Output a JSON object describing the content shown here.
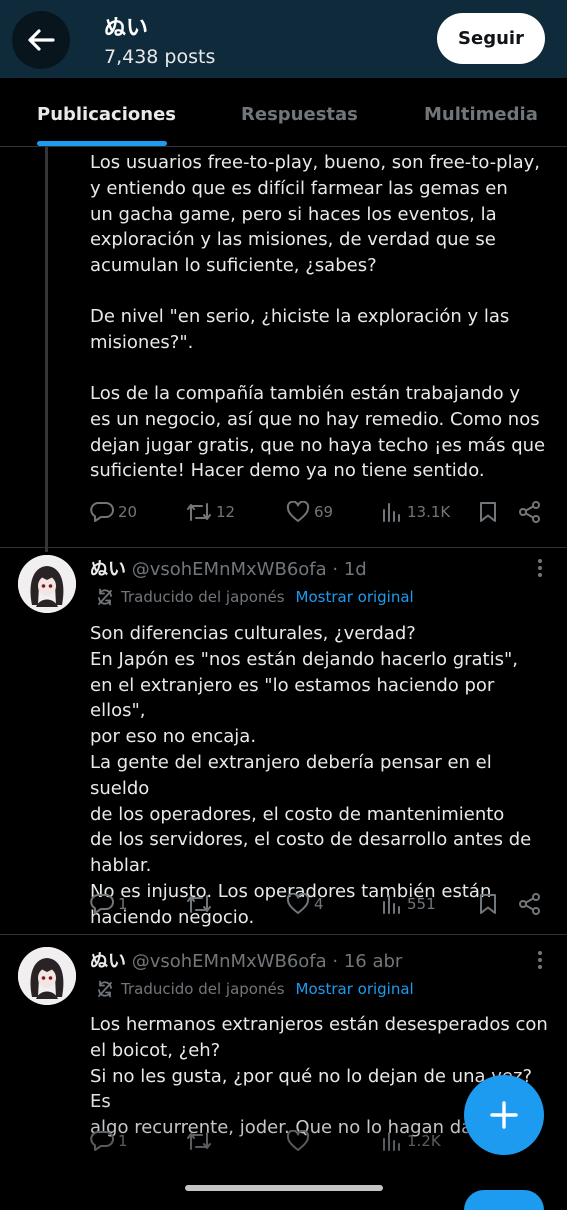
{
  "header": {
    "name": "ぬい",
    "posts_count": "7,438 posts",
    "follow_label": "Seguir"
  },
  "tabs": [
    {
      "label": "Publicaciones",
      "active": true
    },
    {
      "label": "Respuestas",
      "active": false
    },
    {
      "label": "Multimedia",
      "active": false
    }
  ],
  "thread_post": {
    "paragraph_1": "Los usuarios free-to-play, bueno, son free-to-play,\ny entiendo que es difícil farmear las gemas en\nun gacha game, pero si haces los eventos, la\nexploración y las misiones, de verdad que se\nacumulan lo suficiente, ¿sabes?",
    "paragraph_2": "De nivel \"en serio, ¿hiciste la exploración y las\nmisiones?\".",
    "paragraph_3": "Los de la compañía también están trabajando y\nes un negocio, así que no hay remedio. Como nos\ndejan jugar gratis, que no haya techo ¡es más que\nsuficiente! Hacer demo ya no tiene sentido.",
    "replies": "20",
    "reposts": "12",
    "likes": "69",
    "views": "13.1K"
  },
  "post_2": {
    "display_name": "ぬい",
    "handle": "@vsohEMnMxWB6ofa",
    "time": "· 1d",
    "translated_label": "Traducido del japonés",
    "show_original": "Mostrar original",
    "text": "Son diferencias culturales, ¿verdad?\nEn Japón es \"nos están dejando hacerlo gratis\",\nen el extranjero es \"lo estamos haciendo por ellos\",\npor eso no encaja.\nLa gente del extranjero debería pensar en el sueldo\nde los operadores, el costo de mantenimiento\nde los servidores, el costo de desarrollo antes de\nhablar.\nNo es injusto. Los operadores también están\nhaciendo negocio.",
    "replies": "1",
    "reposts": "",
    "likes": "4",
    "views": "551"
  },
  "post_3": {
    "display_name": "ぬい",
    "handle": "@vsohEMnMxWB6ofa",
    "time": "· 16 abr",
    "translated_label": "Traducido del japonés",
    "show_original": "Mostrar original",
    "text": "Los hermanos extranjeros están desesperados con\nel boicot, ¿eh?\nSi no les gusta, ¿por qué no lo dejan de una vez? Es\nalgo recurrente, joder. Que no lo hagan da r",
    "replies": "1",
    "reposts": "",
    "likes": "",
    "views": "1.2K"
  },
  "icons": {
    "back": "arrow-left-icon",
    "reply": "speech-bubble-icon",
    "repost": "retweet-icon",
    "like": "heart-icon",
    "views": "bar-chart-icon",
    "bookmark": "bookmark-icon",
    "share": "share-icon",
    "translate": "translate-sync-icon",
    "more": "more-vertical-icon",
    "compose": "plus-icon"
  },
  "colors": {
    "header_bg": "#0e2a3b",
    "accent": "#1d9bf0",
    "muted": "#71767b",
    "text": "#e7e9ea"
  }
}
